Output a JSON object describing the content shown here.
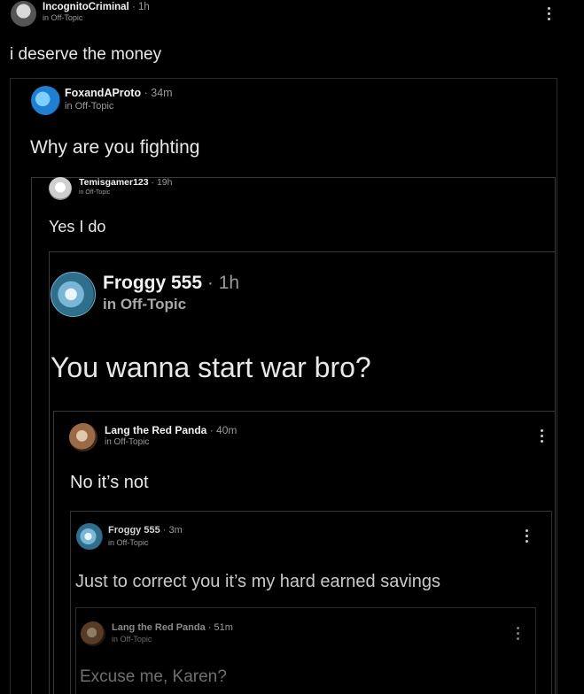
{
  "post": {
    "author": "IncognitoCriminal",
    "time": "1h",
    "community": "in Off-Topic",
    "text": "i deserve the money"
  },
  "quote1": {
    "author": "FoxandAProto",
    "time": "34m",
    "community": "in Off-Topic",
    "text": "Why are you fighting"
  },
  "quote2": {
    "author": "Temisgamer123",
    "time": "19h",
    "community": "in Off-Topic",
    "text": "Yes I do"
  },
  "quote3": {
    "author": "Froggy 555",
    "time": "1h",
    "community": "in Off-Topic",
    "text": "You wanna start war bro?"
  },
  "quote4": {
    "author": "Lang the Red Panda",
    "time": "40m",
    "community": "in Off-Topic",
    "text": "No it’s not"
  },
  "quote5": {
    "author": "Froggy 555",
    "time": "3m",
    "community": "in Off-Topic",
    "text": "Just to correct you it’s my hard earned savings"
  },
  "quote6": {
    "author": "Lang the Red Panda",
    "time": "51m",
    "community": "in Off-Topic",
    "text": "Excuse me, Karen?"
  },
  "separator": "·",
  "icons": {
    "more": "more-options-icon",
    "avatar": "avatar"
  }
}
